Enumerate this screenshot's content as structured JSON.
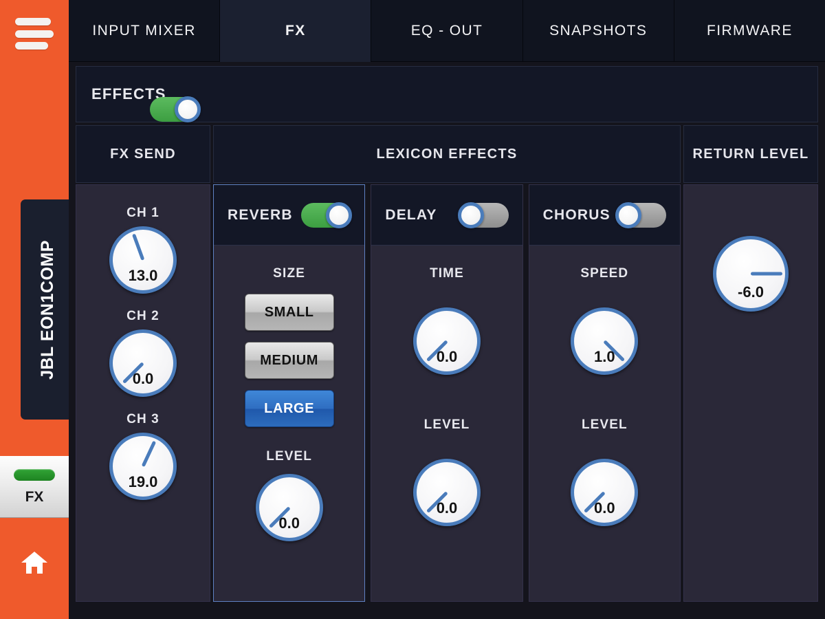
{
  "rail": {
    "menu_icon": "hamburger-icon",
    "device_name": "JBL EON1COMP",
    "fx_button_label": "FX",
    "home_icon": "home-icon",
    "accent_color": "#ef5a2c",
    "indicator_color": "#2a9430"
  },
  "tabs": [
    {
      "label": "INPUT MIXER",
      "active": false
    },
    {
      "label": "FX",
      "active": true
    },
    {
      "label": "EQ - OUT",
      "active": false
    },
    {
      "label": "SNAPSHOTS",
      "active": false
    },
    {
      "label": "FIRMWARE",
      "active": false
    }
  ],
  "effects_bar": {
    "title": "EFFECTS",
    "master_toggle": "on"
  },
  "columns": {
    "fx_send_header": "FX SEND",
    "lexicon_header": "LEXICON EFFECTS",
    "return_header": "RETURN LEVEL"
  },
  "fx_send": {
    "knobs": [
      {
        "label": "CH 1",
        "value": "13.0",
        "angle": -20
      },
      {
        "label": "CH 2",
        "value": "0.0",
        "angle": -135
      },
      {
        "label": "CH 3",
        "value": "19.0",
        "angle": 25
      }
    ]
  },
  "effects": [
    {
      "name": "REVERB",
      "toggle": "on",
      "selected": true,
      "size_title": "SIZE",
      "size_options": [
        {
          "label": "SMALL",
          "selected": false
        },
        {
          "label": "MEDIUM",
          "selected": false
        },
        {
          "label": "LARGE",
          "selected": true
        }
      ],
      "level_label": "LEVEL",
      "level_value": "0.0",
      "level_angle": -135
    },
    {
      "name": "DELAY",
      "toggle": "off",
      "selected": false,
      "top_label": "TIME",
      "top_value": "0.0",
      "top_angle": -135,
      "level_label": "LEVEL",
      "level_value": "0.0",
      "level_angle": -135
    },
    {
      "name": "CHORUS",
      "toggle": "off",
      "selected": false,
      "top_label": "SPEED",
      "top_value": "1.0",
      "top_angle": 135,
      "level_label": "LEVEL",
      "level_value": "0.0",
      "level_angle": -135
    }
  ],
  "return_level": {
    "value": "-6.0",
    "angle": 90
  },
  "colors": {
    "orange": "#ef5a2c",
    "panel_bg": "#2a2838",
    "header_bg": "#131726",
    "knob_ring": "#4a7cbb",
    "toggle_on": "#4eae52",
    "toggle_off": "#9a9a9a",
    "button_active": "#2f6ec1"
  }
}
